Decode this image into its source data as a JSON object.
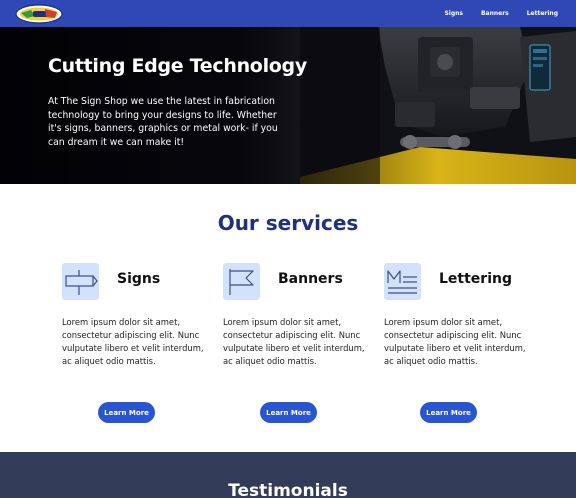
{
  "header": {
    "logo_icon": "sign-shop-logo",
    "nav": [
      "Signs",
      "Banners",
      "Lettering"
    ],
    "color": "#2f48b6"
  },
  "hero": {
    "title": "Cutting Edge Technology",
    "text": "At The Sign Shop we use the latest in fabrication technology to bring your designs to life. Whether it's signs, banners, graphics or metal work- if you can dream it we can make it!"
  },
  "services": {
    "title": "Our services",
    "items": [
      {
        "icon": "signpost-icon",
        "name": "Signs",
        "description": "Lorem ipsum dolor sit amet, consectetur adipiscing elit. Nunc vulputate libero et velit interdum, ac aliquet odio mattis.",
        "button": "Learn More"
      },
      {
        "icon": "flag-icon",
        "name": "Banners",
        "description": "Lorem ipsum dolor sit amet, consectetur adipiscing elit. Nunc vulputate libero et velit interdum, ac aliquet odio mattis.",
        "button": "Learn More"
      },
      {
        "icon": "lettering-icon",
        "name": "Lettering",
        "description": "Lorem ipsum dolor sit amet, consectetur adipiscing elit. Nunc vulputate libero et velit interdum, ac aliquet odio mattis.",
        "button": "Learn More"
      }
    ],
    "button_color": "#2a55d2",
    "title_color": "#1d2f86"
  },
  "testimonials": {
    "title": "Testimonials",
    "color": "#323c59"
  }
}
